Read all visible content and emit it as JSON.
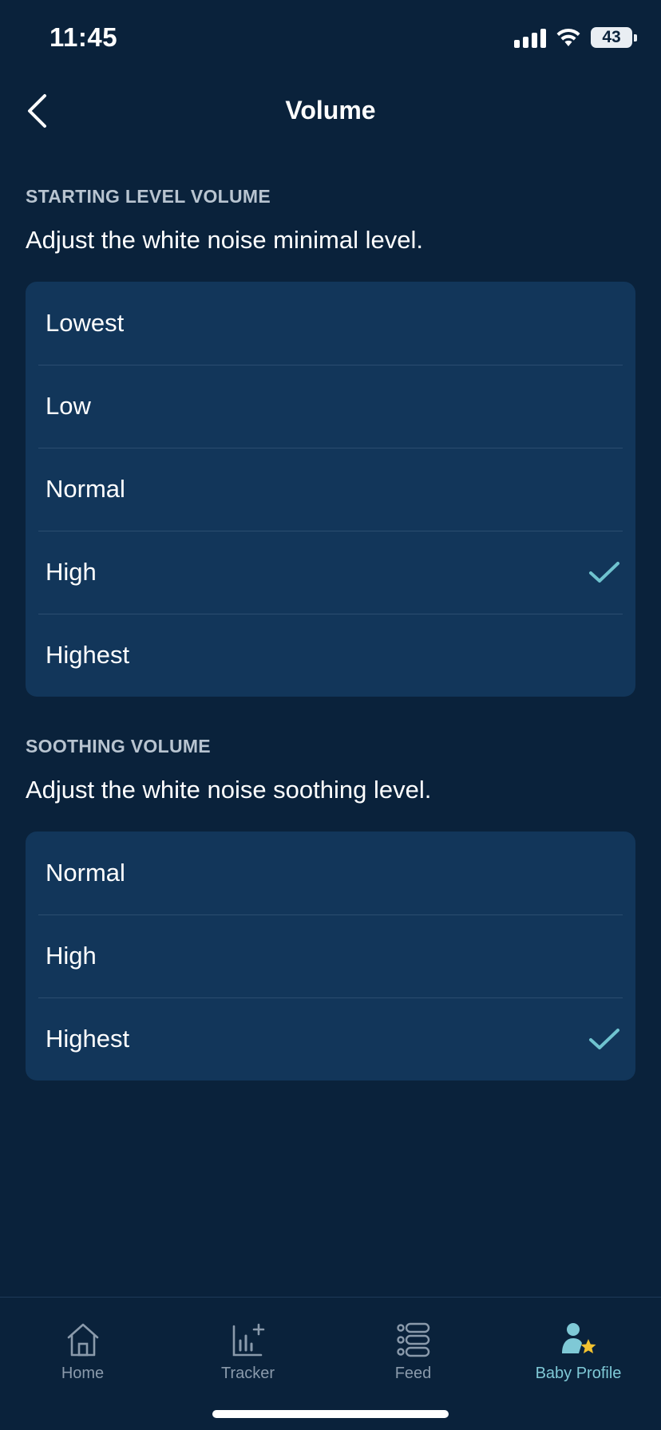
{
  "status_bar": {
    "time": "11:45",
    "battery": "43"
  },
  "header": {
    "title": "Volume"
  },
  "starting": {
    "label": "STARTING LEVEL VOLUME",
    "description": "Adjust the white noise minimal level.",
    "options": [
      "Lowest",
      "Low",
      "Normal",
      "High",
      "Highest"
    ],
    "selected": "High"
  },
  "soothing": {
    "label": "SOOTHING VOLUME",
    "description": "Adjust the white noise soothing level.",
    "options": [
      "Normal",
      "High",
      "Highest"
    ],
    "selected": "Highest"
  },
  "tabs": [
    {
      "label": "Home",
      "icon": "home-icon"
    },
    {
      "label": "Tracker",
      "icon": "tracker-icon"
    },
    {
      "label": "Feed",
      "icon": "feed-icon"
    },
    {
      "label": "Baby Profile",
      "icon": "baby-profile-icon",
      "active": true
    }
  ],
  "colors": {
    "background": "#0a223b",
    "card": "#12365a",
    "accent": "#7fc9d6",
    "check": "#6fc3cf"
  }
}
